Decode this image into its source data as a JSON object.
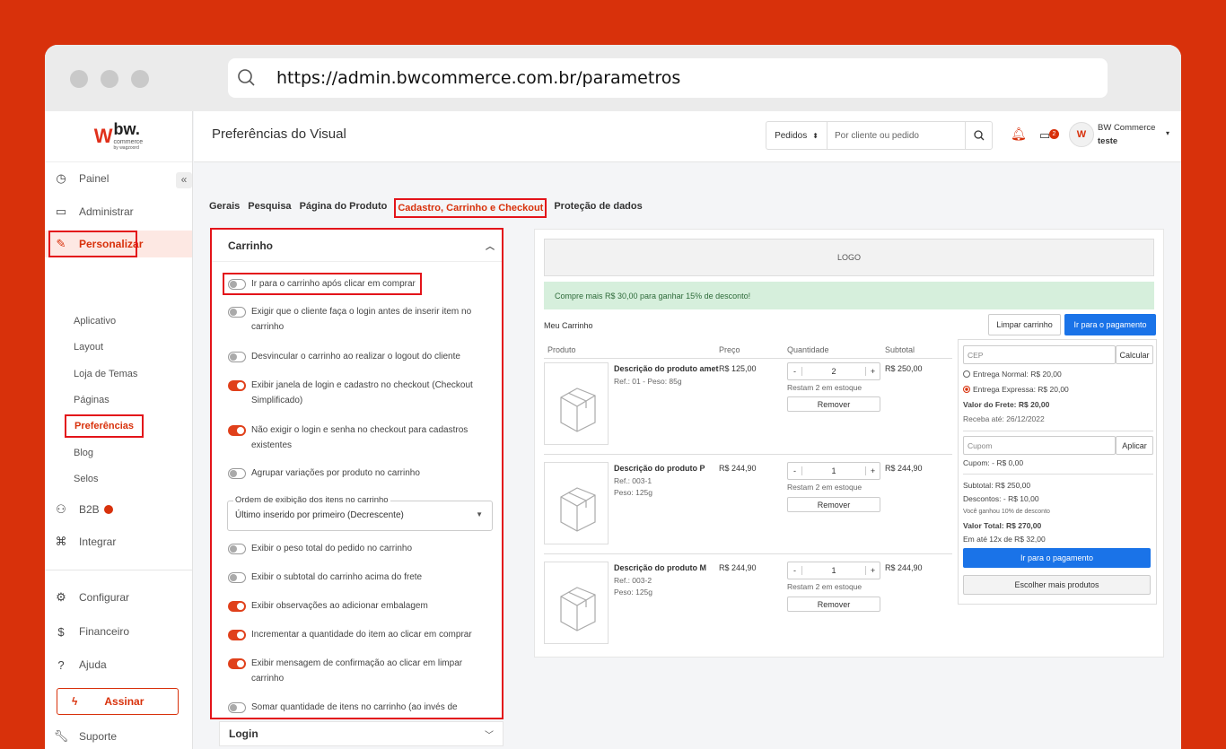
{
  "browser": {
    "url": "https://admin.bwcommerce.com.br/parametros"
  },
  "logo": {
    "mark": "W",
    "name": "bw.",
    "sub": "commerce",
    "tiny": "by wagzoord"
  },
  "colors": {
    "brand": "#d8310b",
    "accent_blue": "#1a73e8",
    "highlight": "#e3141a"
  },
  "sidebar": {
    "collapse": "«",
    "items": [
      {
        "label": "Painel",
        "icon": "clock-icon"
      },
      {
        "label": "Administrar",
        "icon": "monitor-icon"
      },
      {
        "label": "Personalizar",
        "icon": "pencil-icon"
      },
      {
        "label": "B2B",
        "icon": "users-icon"
      },
      {
        "label": "Integrar",
        "icon": "command-icon"
      },
      {
        "label": "Configurar",
        "icon": "gear-icon"
      },
      {
        "label": "Financeiro",
        "icon": "dollar-icon"
      },
      {
        "label": "Ajuda",
        "icon": "help-icon"
      },
      {
        "label": "Suporte",
        "icon": "wrench-icon"
      }
    ],
    "subitems": [
      "Aplicativo",
      "Layout",
      "Loja de Temas",
      "Páginas",
      "Preferências",
      "Blog",
      "Selos"
    ],
    "assinar": "Assinar"
  },
  "header": {
    "title": "Preferências do Visual",
    "search_select": "Pedidos",
    "search_placeholder": "Por cliente ou pedido",
    "chat_badge": "2",
    "user_name": "BW Commerce",
    "user_sub": "teste"
  },
  "tabs": [
    "Gerais",
    "Pesquisa",
    "Página do Produto",
    "Cadastro, Carrinho e Checkout",
    "Proteção de dados"
  ],
  "panel": {
    "title": "Carrinho",
    "options": [
      {
        "label": "Ir para o carrinho após clicar em comprar",
        "on": false
      },
      {
        "label": "Exigir que o cliente faça o login antes de inserir item no carrinho",
        "on": false
      },
      {
        "label": "Desvincular o carrinho ao realizar o logout do cliente",
        "on": false
      },
      {
        "label": "Exibir janela de login e cadastro no checkout (Checkout Simplificado)",
        "on": true
      },
      {
        "label": "Não exigir o login e senha no checkout para cadastros existentes",
        "on": true
      },
      {
        "label": "Agrupar variações por produto no carrinho",
        "on": false
      }
    ],
    "select_label": "Ordem de exibição dos itens no carrinho",
    "select_value": "Último inserido por primeiro (Decrescente)",
    "options2": [
      {
        "label": "Exibir o peso total do pedido no carrinho",
        "on": false
      },
      {
        "label": "Exibir o subtotal do carrinho acima do frete",
        "on": false
      },
      {
        "label": "Exibir observações ao adicionar embalagem",
        "on": true
      },
      {
        "label": "Incrementar a quantidade do item ao clicar em comprar",
        "on": true
      },
      {
        "label": "Exibir mensagem de confirmação ao clicar em limpar carrinho",
        "on": true
      },
      {
        "label": "Somar quantidade de itens no carrinho (ao invés de",
        "on": false
      }
    ],
    "login_title": "Login"
  },
  "preview": {
    "logo": "LOGO",
    "promo": "Compre mais R$ 30,00 para ganhar 15% de desconto!",
    "cart_title": "Meu Carrinho",
    "clear": "Limpar carrinho",
    "pay": "Ir para o pagamento",
    "cols": [
      "Produto",
      "Preço",
      "Quantidade",
      "Subtotal"
    ],
    "items": [
      {
        "name": "Descrição do produto amet",
        "meta1": "Ref.: 01 - Peso: 85g",
        "meta2": "",
        "price": "R$ 125,00",
        "qty": "2",
        "stock": "Restam 2 em estoque",
        "remove": "Remover",
        "subtotal": "R$ 250,00"
      },
      {
        "name": "Descrição do produto P",
        "meta1": "Ref.: 003-1",
        "meta2": "Peso: 125g",
        "price": "R$ 244,90",
        "qty": "1",
        "stock": "Restam 2 em estoque",
        "remove": "Remover",
        "subtotal": "R$ 244,90"
      },
      {
        "name": "Descrição do produto M",
        "meta1": "Ref.: 003-2",
        "meta2": "Peso: 125g",
        "price": "R$ 244,90",
        "qty": "1",
        "stock": "Restam 2 em estoque",
        "remove": "Remover",
        "subtotal": "R$ 244,90"
      }
    ],
    "summary": {
      "cep": "CEP",
      "calc": "Calcular",
      "ship1": "Entrega Normal: R$ 20,00",
      "ship2": "Entrega Expressa: R$ 20,00",
      "frete": "Valor do Frete: R$ 20,00",
      "receba": "Receba até: 26/12/2022",
      "cupom": "Cupom",
      "aplicar": "Aplicar",
      "cupom_val": "Cupom: - R$ 0,00",
      "subtotal": "Subtotal: R$ 250,00",
      "descontos": "Descontos: - R$ 10,00",
      "ganhou": "Você ganhou 10% de desconto",
      "total": "Valor Total: R$ 270,00",
      "parcelas": "Em até 12x de R$ 32,00",
      "pay": "Ir para o pagamento",
      "more": "Escolher mais produtos"
    }
  }
}
